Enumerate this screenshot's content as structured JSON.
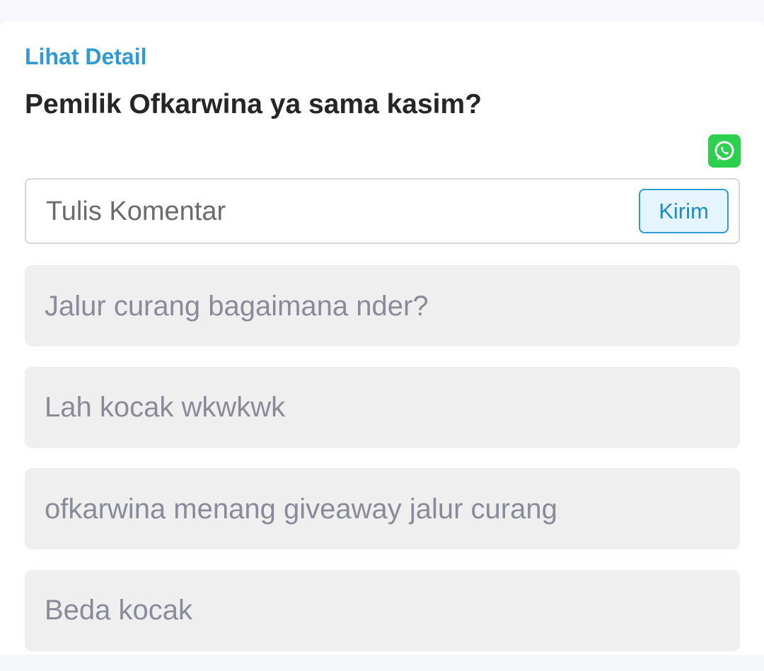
{
  "post": {
    "detail_link": "Lihat Detail",
    "question": "Pemilik Ofkarwina ya sama kasim?",
    "share_icon": "whatsapp-icon"
  },
  "comment_form": {
    "placeholder": "Tulis Komentar",
    "value": "",
    "send_label": "Kirim"
  },
  "comments": [
    {
      "text": "Jalur curang bagaimana nder?"
    },
    {
      "text": "Lah kocak wkwkwk"
    },
    {
      "text": "ofkarwina menang giveaway jalur curang"
    },
    {
      "text": "Beda kocak"
    }
  ],
  "colors": {
    "accent": "#2e9ad6",
    "whatsapp": "#2bd04f",
    "comment_bg": "#efefef",
    "comment_text": "#8a8a99"
  }
}
